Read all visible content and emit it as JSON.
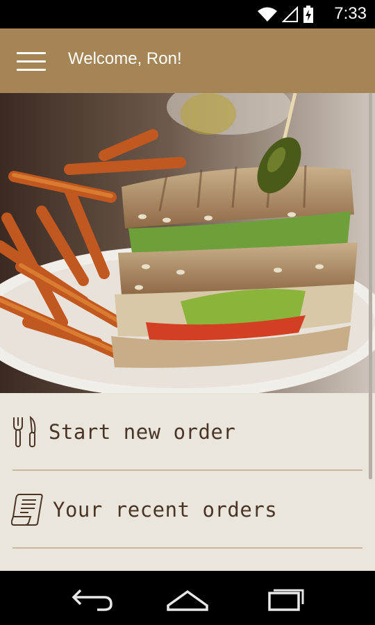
{
  "status_bar": {
    "time": "7:33"
  },
  "app_bar": {
    "title": "Welcome, Ron!"
  },
  "menu": {
    "items": [
      {
        "label": "Start new order",
        "icon": "fork-knife-icon"
      },
      {
        "label": "Your recent orders",
        "icon": "receipt-scroll-icon"
      }
    ]
  },
  "nav_bar": {
    "buttons": [
      "back-icon",
      "home-icon",
      "recent-apps-icon"
    ]
  },
  "colors": {
    "app_bar": "#a58556",
    "menu_background": "#ebe6dc",
    "menu_text": "#4a3426"
  }
}
